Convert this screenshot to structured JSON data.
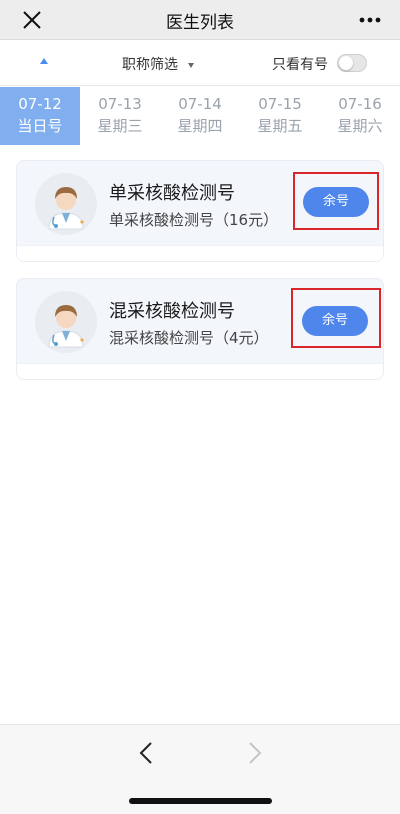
{
  "header": {
    "title": "医生列表",
    "close_icon": "close-icon",
    "more_icon": "more-dots-icon"
  },
  "filters": {
    "title_filter_label": "职称筛选",
    "only_available_label": "只看有号",
    "only_available_on": false
  },
  "dates": [
    {
      "date": "07-12",
      "weekday": "当日号",
      "active": true
    },
    {
      "date": "07-13",
      "weekday": "星期三",
      "active": false
    },
    {
      "date": "07-14",
      "weekday": "星期四",
      "active": false
    },
    {
      "date": "07-15",
      "weekday": "星期五",
      "active": false
    },
    {
      "date": "07-16",
      "weekday": "星期六",
      "active": false
    }
  ],
  "cards": [
    {
      "name": "单采核酸检测号",
      "description": "单采核酸检测号（16元）",
      "button_label": "余号",
      "avatar_icon": "doctor-avatar-icon"
    },
    {
      "name": "混采核酸检测号",
      "description": "混采核酸检测号（4元）",
      "button_label": "余号",
      "avatar_icon": "doctor-avatar-icon"
    }
  ],
  "colors": {
    "accent": "#4f86ec",
    "active_date_bg": "#80aeee",
    "highlight_frame": "#d9262b",
    "card_bg": "#f3f6fb"
  },
  "navbar": {
    "back_icon": "chevron-left-icon",
    "forward_icon": "chevron-right-icon"
  }
}
